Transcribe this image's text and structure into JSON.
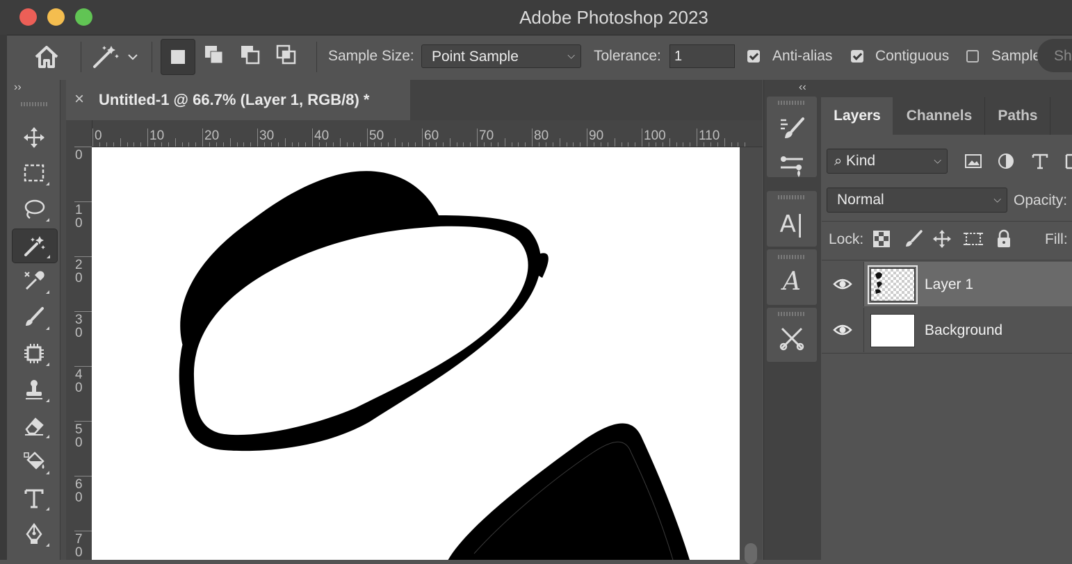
{
  "window": {
    "title": "Adobe Photoshop 2023"
  },
  "options_bar": {
    "sample_size_label": "Sample Size:",
    "sample_size_value": "Point Sample",
    "tolerance_label": "Tolerance:",
    "tolerance_value": "1",
    "anti_alias_label": "Anti-alias",
    "anti_alias_checked": true,
    "contiguous_label": "Contiguous",
    "contiguous_checked": true,
    "sample_all_label": "Sample",
    "select_subject_label": "Sh"
  },
  "document": {
    "tab_title": "Untitled-1 @ 66.7% (Layer 1, RGB/8) *",
    "close_glyph": "×",
    "ruler_h": [
      "0",
      "10",
      "20",
      "30",
      "40",
      "50",
      "60",
      "70",
      "80",
      "90",
      "100",
      "110"
    ],
    "ruler_v": [
      [
        "0",
        ""
      ],
      [
        "1",
        "0"
      ],
      [
        "2",
        "0"
      ],
      [
        "3",
        "0"
      ],
      [
        "4",
        "0"
      ],
      [
        "5",
        "0"
      ],
      [
        "6",
        "0"
      ],
      [
        "7",
        "0"
      ]
    ]
  },
  "panel_collapse": {
    "left": "››",
    "right": "‹‹"
  },
  "layers_panel": {
    "tabs": [
      "Layers",
      "Channels",
      "Paths"
    ],
    "active_tab": "Layers",
    "filter_value": "Kind",
    "blend_mode": "Normal",
    "opacity_label": "Opacity:",
    "lock_label": "Lock:",
    "fill_label": "Fill:",
    "layers": [
      {
        "name": "Layer 1",
        "visible": true,
        "selected": true
      },
      {
        "name": "Background",
        "visible": true,
        "selected": false
      }
    ]
  },
  "tools": [
    "move-tool",
    "marquee-tool",
    "lasso-tool",
    "magic-wand-tool",
    "eyedropper-tool",
    "brush-tool",
    "frame-tool",
    "stamp-tool",
    "eraser-tool",
    "paint-bucket-tool",
    "type-tool",
    "pen-tool"
  ],
  "active_tool": "magic-wand-tool",
  "colors": {
    "close": "#ec5f57",
    "minimize": "#f4bd4f",
    "maximize": "#61c454",
    "panel": "#535353",
    "titlebar": "#3d3d3d"
  }
}
